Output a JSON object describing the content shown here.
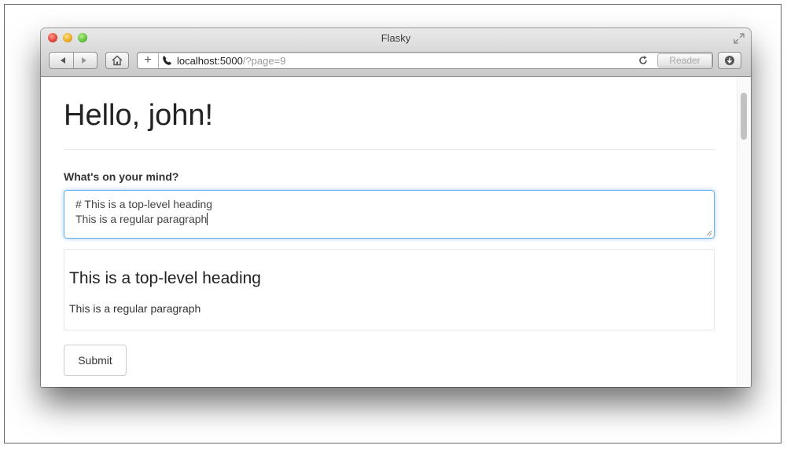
{
  "browser": {
    "window_title": "Flasky",
    "url_host": "localhost:5000",
    "url_path": "/?page=9",
    "reader_label": "Reader"
  },
  "page": {
    "title": "Hello, john!",
    "form": {
      "field_label": "What's on your mind?",
      "body_line1": "# This is a top-level heading",
      "body_line2": "This is a regular paragraph",
      "submit_label": "Submit"
    },
    "preview": {
      "heading": "This is a top-level heading",
      "paragraph": "This is a regular paragraph"
    }
  },
  "colors": {
    "focus_border": "#66afe9",
    "close": "#e0443a",
    "minimize": "#e8a922",
    "zoom": "#5fbf3a"
  },
  "icons": [
    "back-icon",
    "forward-icon",
    "home-icon",
    "add-bookmark-icon",
    "phone-icon",
    "reload-icon",
    "download-icon",
    "fullscreen-icon"
  ]
}
